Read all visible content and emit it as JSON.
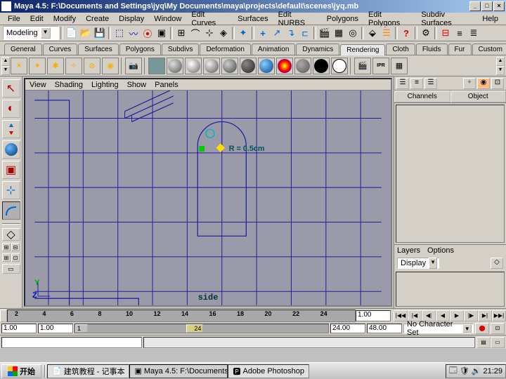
{
  "titlebar": {
    "title": "Maya 4.5: F:\\Documents and Settings\\jyq\\My Documents\\maya\\projects\\default\\scenes\\jyq.mb",
    "min": "_",
    "max": "□",
    "close": "×"
  },
  "menubar": [
    "File",
    "Edit",
    "Modify",
    "Create",
    "Display",
    "Window",
    "Edit Curves",
    "Surfaces",
    "Edit NURBS",
    "Polygons",
    "Edit Polygons",
    "Subdiv Surfaces",
    "Help"
  ],
  "mode_dropdown": "Modeling",
  "tabs": [
    "General",
    "Curves",
    "Surfaces",
    "Polygons",
    "Subdivs",
    "Deformation",
    "Animation",
    "Dynamics",
    "Rendering",
    "Cloth",
    "Fluids",
    "Fur",
    "Custom"
  ],
  "active_tab": "Rendering",
  "viewport": {
    "menus": [
      "View",
      "Shading",
      "Lighting",
      "Show",
      "Panels"
    ],
    "label": "side",
    "annotation": "R = 0.5cm",
    "axes": {
      "y": "Y",
      "z": "Z"
    }
  },
  "channelbox": {
    "tabs": [
      "Channels",
      "Object"
    ],
    "layers_menu": [
      "Layers",
      "Options"
    ],
    "display_dropdown": "Display"
  },
  "timeslider": {
    "ticks": [
      "2",
      "4",
      "6",
      "8",
      "10",
      "12",
      "14",
      "16",
      "18",
      "20",
      "22",
      "24"
    ],
    "current": "1.00",
    "end_btns": [
      "<<",
      ">>"
    ]
  },
  "rangeslider": {
    "start_outer": "1.00",
    "start_inner": "1.00",
    "handle_start": "1",
    "handle_end": "24",
    "end_inner": "24.00",
    "end_outer": "48.00",
    "charset": "No Character Set"
  },
  "taskbar": {
    "start": "开始",
    "tasks": [
      "建筑教程 - 记事本",
      "Maya 4.5: F:\\Documents...",
      "Adobe Photoshop"
    ],
    "clock": "21:29"
  },
  "shelf_spheres": [
    "#888",
    "#999",
    "#888",
    "#888",
    "#555",
    "#4af",
    "#f44",
    "#888",
    "#000"
  ]
}
